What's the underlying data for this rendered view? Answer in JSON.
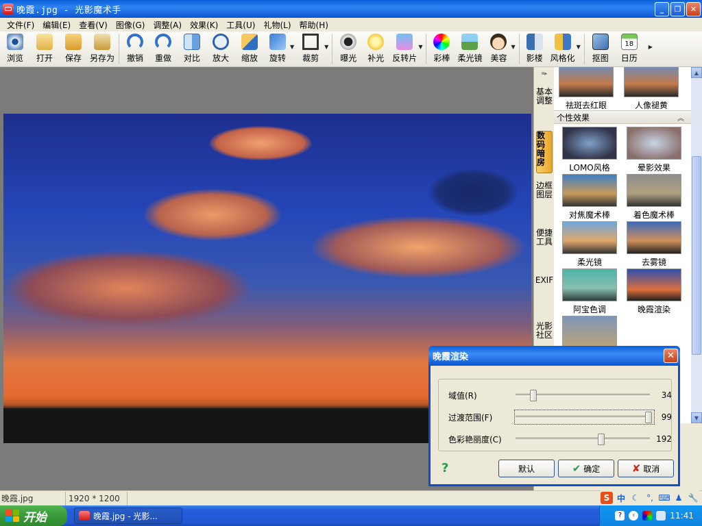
{
  "window": {
    "title": "晚霞.jpg - 光影魔术手"
  },
  "menu": [
    "文件(F)",
    "编辑(E)",
    "查看(V)",
    "图像(G)",
    "调整(A)",
    "效果(K)",
    "工具(U)",
    "礼物(L)",
    "帮助(H)"
  ],
  "toolbar": {
    "browse": "浏览",
    "open": "打开",
    "save": "保存",
    "save_as": "另存为",
    "undo": "撤销",
    "redo": "重做",
    "compare": "对比",
    "zoom_in": "放大",
    "resize": "缩放",
    "rotate": "旋转",
    "crop": "裁剪",
    "exposure": "曝光",
    "fill_light": "补光",
    "reverse_film": "反转片",
    "color_pen": "彩棒",
    "soft_light": "柔光镜",
    "beauty": "美容",
    "studio": "影楼",
    "stylize": "风格化",
    "cutout": "抠图",
    "calendar": "日历"
  },
  "side_tabs": [
    "基本调整",
    "数码暗房",
    "边框图层",
    "便捷工具",
    "EXIF",
    "光影社区"
  ],
  "panel": {
    "top_items": [
      "祛斑去红眼",
      "人像褪黄"
    ],
    "section_title": "个性效果",
    "effects": [
      "LOMO风格",
      "晕影效果",
      "对焦魔术棒",
      "着色魔术棒",
      "柔光镜",
      "去雾镜",
      "阿宝色调",
      "晚霞渲染"
    ]
  },
  "status": {
    "filename": "晚霞.jpg",
    "dimensions": "1920 * 1200"
  },
  "dialog": {
    "title": "晚霞渲染",
    "sliders": [
      {
        "label": "域值(R)",
        "value": "34",
        "min": 0,
        "max": 255,
        "pos": 34
      },
      {
        "label": "过渡范围(F)",
        "value": "99",
        "min": 0,
        "max": 100,
        "pos": 99
      },
      {
        "label": "色彩艳丽度(C)",
        "value": "192",
        "min": 0,
        "max": 300,
        "pos": 192
      }
    ],
    "buttons": {
      "default": "默认",
      "ok": "确定",
      "cancel": "取消"
    }
  },
  "taskbar": {
    "start": "开始",
    "task": "晚霞.jpg - 光影...",
    "clock": "11:41",
    "ime": "中"
  },
  "colors": {
    "title_blue": "#0a5fd8",
    "taskbar_blue": "#245fdc",
    "start_green": "#3c9e3b",
    "active_tab": "#e8a628"
  }
}
